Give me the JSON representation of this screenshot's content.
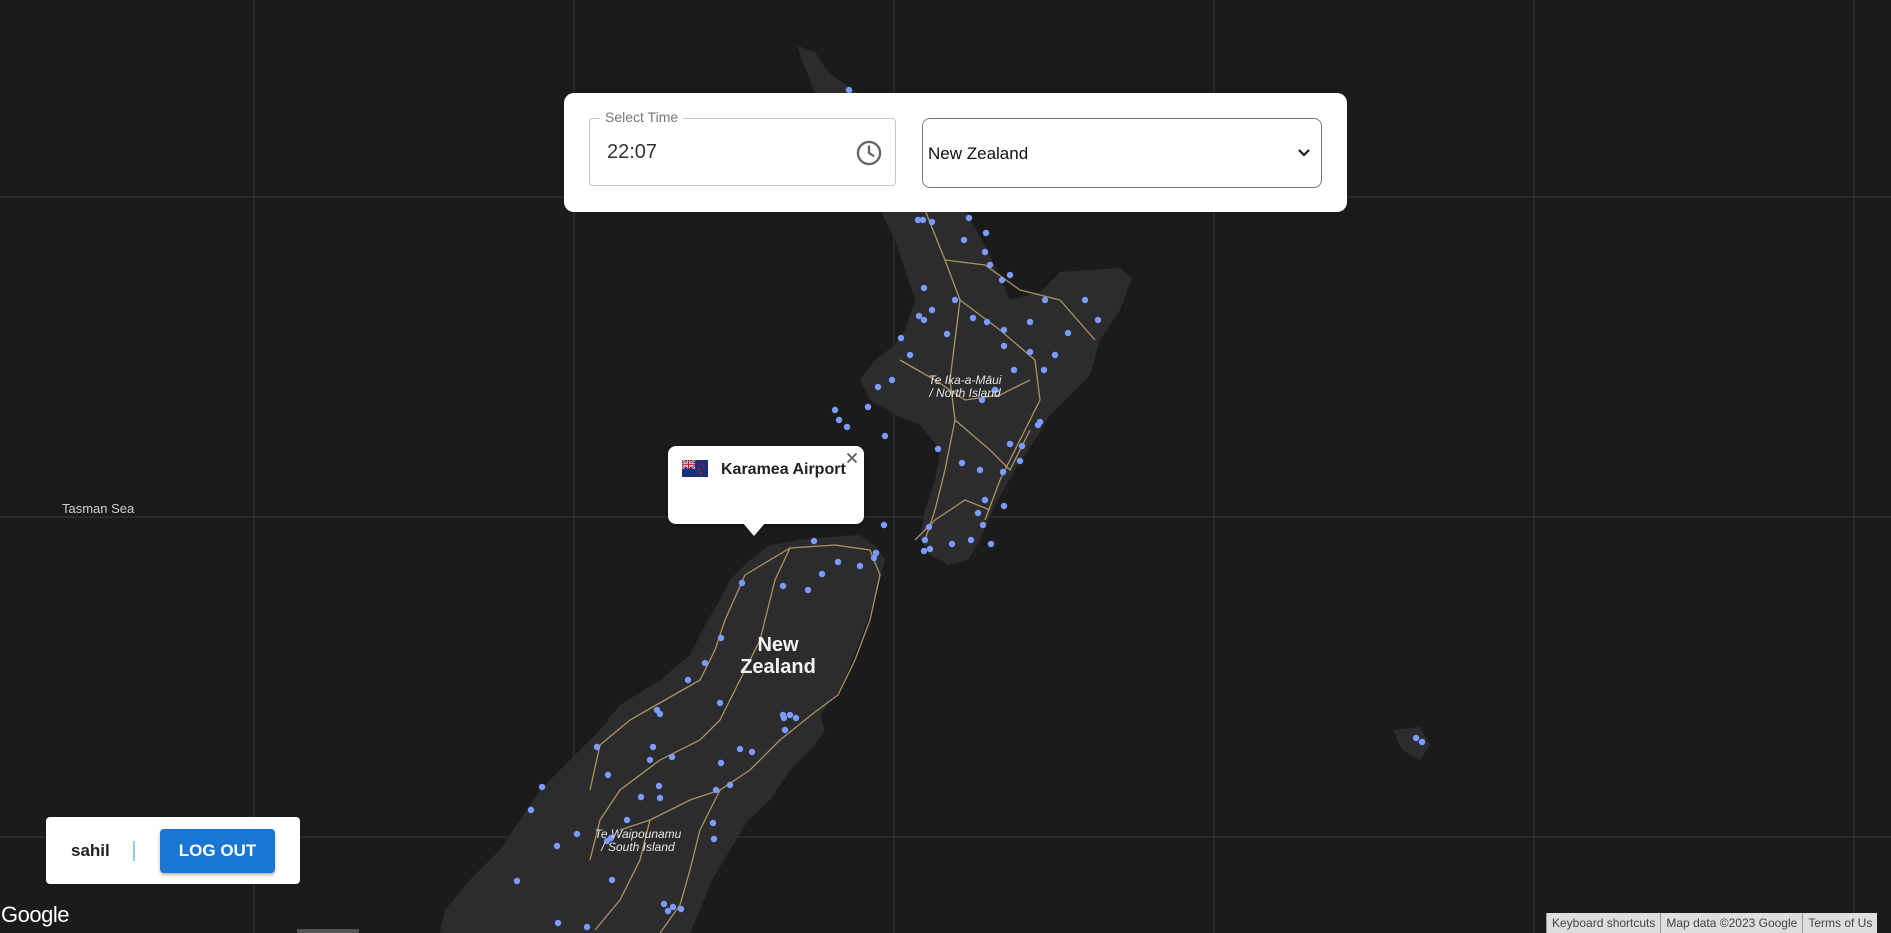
{
  "time_picker": {
    "label": "Select Time",
    "value": "22:07"
  },
  "country_select": {
    "selected": "New Zealand"
  },
  "map": {
    "labels": {
      "sea": "Tasman Sea",
      "north_island": [
        "Te Ika-a-Māui",
        "/ North Island"
      ],
      "south_island": [
        "Te Waipounamu",
        "/ South Island"
      ],
      "country": [
        "New",
        "Zealand"
      ]
    },
    "marker_color": "#7b9cff",
    "road_color": "#c2a46a",
    "land_color": "#2c2c2e",
    "water_color": "#1b1b1c"
  },
  "popup": {
    "title": "Karamea Airport",
    "flag": "new-zealand-flag-icon"
  },
  "user": {
    "name": "sahil",
    "logout_label": "LOG OUT"
  },
  "footer": {
    "logo": "Google",
    "keyboard_shortcuts": "Keyboard shortcuts",
    "map_data": "Map data ©2023 Google",
    "terms": "Terms of Us"
  },
  "colors": {
    "accent": "#1976d2",
    "panel": "#ffffff"
  }
}
